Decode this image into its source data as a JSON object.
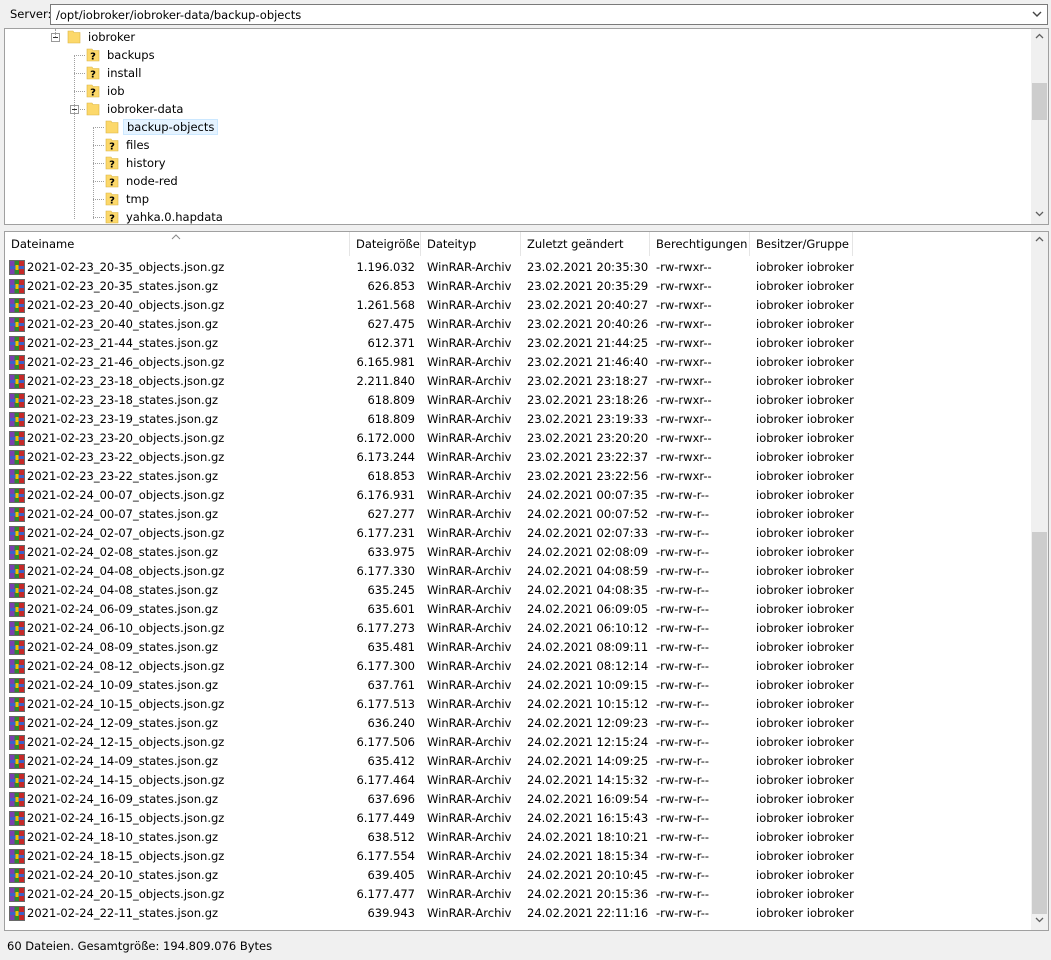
{
  "server": {
    "label": "Server:",
    "path": "/opt/iobroker/iobroker-data/backup-objects"
  },
  "tree": [
    {
      "name": "iobroker",
      "level": 0,
      "icon": "folder",
      "expanded": true
    },
    {
      "name": "backups",
      "level": 1,
      "icon": "unknown-folder"
    },
    {
      "name": "install",
      "level": 1,
      "icon": "unknown-folder"
    },
    {
      "name": "iob",
      "level": 1,
      "icon": "unknown-folder"
    },
    {
      "name": "iobroker-data",
      "level": 1,
      "icon": "folder",
      "expanded": true
    },
    {
      "name": "backup-objects",
      "level": 2,
      "icon": "folder",
      "selected": true
    },
    {
      "name": "files",
      "level": 2,
      "icon": "unknown-folder"
    },
    {
      "name": "history",
      "level": 2,
      "icon": "unknown-folder"
    },
    {
      "name": "node-red",
      "level": 2,
      "icon": "unknown-folder"
    },
    {
      "name": "tmp",
      "level": 2,
      "icon": "unknown-folder"
    },
    {
      "name": "yahka.0.hapdata",
      "level": 2,
      "icon": "unknown-folder"
    }
  ],
  "columns": {
    "name": "Dateiname",
    "size": "Dateigröße",
    "type": "Dateityp",
    "modified": "Zuletzt geändert",
    "permissions": "Berechtigungen",
    "owner": "Besitzer/Gruppe"
  },
  "files": [
    {
      "name": "2021-02-23_20-35_objects.json.gz",
      "size": "1.196.032",
      "type": "WinRAR-Archiv",
      "modified": "23.02.2021 20:35:30",
      "permissions": "-rw-rwxr--",
      "owner": "iobroker iobroker"
    },
    {
      "name": "2021-02-23_20-35_states.json.gz",
      "size": "626.853",
      "type": "WinRAR-Archiv",
      "modified": "23.02.2021 20:35:29",
      "permissions": "-rw-rwxr--",
      "owner": "iobroker iobroker"
    },
    {
      "name": "2021-02-23_20-40_objects.json.gz",
      "size": "1.261.568",
      "type": "WinRAR-Archiv",
      "modified": "23.02.2021 20:40:27",
      "permissions": "-rw-rwxr--",
      "owner": "iobroker iobroker"
    },
    {
      "name": "2021-02-23_20-40_states.json.gz",
      "size": "627.475",
      "type": "WinRAR-Archiv",
      "modified": "23.02.2021 20:40:26",
      "permissions": "-rw-rwxr--",
      "owner": "iobroker iobroker"
    },
    {
      "name": "2021-02-23_21-44_states.json.gz",
      "size": "612.371",
      "type": "WinRAR-Archiv",
      "modified": "23.02.2021 21:44:25",
      "permissions": "-rw-rwxr--",
      "owner": "iobroker iobroker"
    },
    {
      "name": "2021-02-23_21-46_objects.json.gz",
      "size": "6.165.981",
      "type": "WinRAR-Archiv",
      "modified": "23.02.2021 21:46:40",
      "permissions": "-rw-rwxr--",
      "owner": "iobroker iobroker"
    },
    {
      "name": "2021-02-23_23-18_objects.json.gz",
      "size": "2.211.840",
      "type": "WinRAR-Archiv",
      "modified": "23.02.2021 23:18:27",
      "permissions": "-rw-rwxr--",
      "owner": "iobroker iobroker"
    },
    {
      "name": "2021-02-23_23-18_states.json.gz",
      "size": "618.809",
      "type": "WinRAR-Archiv",
      "modified": "23.02.2021 23:18:26",
      "permissions": "-rw-rwxr--",
      "owner": "iobroker iobroker"
    },
    {
      "name": "2021-02-23_23-19_states.json.gz",
      "size": "618.809",
      "type": "WinRAR-Archiv",
      "modified": "23.02.2021 23:19:33",
      "permissions": "-rw-rwxr--",
      "owner": "iobroker iobroker"
    },
    {
      "name": "2021-02-23_23-20_objects.json.gz",
      "size": "6.172.000",
      "type": "WinRAR-Archiv",
      "modified": "23.02.2021 23:20:20",
      "permissions": "-rw-rwxr--",
      "owner": "iobroker iobroker"
    },
    {
      "name": "2021-02-23_23-22_objects.json.gz",
      "size": "6.173.244",
      "type": "WinRAR-Archiv",
      "modified": "23.02.2021 23:22:37",
      "permissions": "-rw-rwxr--",
      "owner": "iobroker iobroker"
    },
    {
      "name": "2021-02-23_23-22_states.json.gz",
      "size": "618.853",
      "type": "WinRAR-Archiv",
      "modified": "23.02.2021 23:22:56",
      "permissions": "-rw-rwxr--",
      "owner": "iobroker iobroker"
    },
    {
      "name": "2021-02-24_00-07_objects.json.gz",
      "size": "6.176.931",
      "type": "WinRAR-Archiv",
      "modified": "24.02.2021 00:07:35",
      "permissions": "-rw-rw-r--",
      "owner": "iobroker iobroker"
    },
    {
      "name": "2021-02-24_00-07_states.json.gz",
      "size": "627.277",
      "type": "WinRAR-Archiv",
      "modified": "24.02.2021 00:07:52",
      "permissions": "-rw-rw-r--",
      "owner": "iobroker iobroker"
    },
    {
      "name": "2021-02-24_02-07_objects.json.gz",
      "size": "6.177.231",
      "type": "WinRAR-Archiv",
      "modified": "24.02.2021 02:07:33",
      "permissions": "-rw-rw-r--",
      "owner": "iobroker iobroker"
    },
    {
      "name": "2021-02-24_02-08_states.json.gz",
      "size": "633.975",
      "type": "WinRAR-Archiv",
      "modified": "24.02.2021 02:08:09",
      "permissions": "-rw-rw-r--",
      "owner": "iobroker iobroker"
    },
    {
      "name": "2021-02-24_04-08_objects.json.gz",
      "size": "6.177.330",
      "type": "WinRAR-Archiv",
      "modified": "24.02.2021 04:08:59",
      "permissions": "-rw-rw-r--",
      "owner": "iobroker iobroker"
    },
    {
      "name": "2021-02-24_04-08_states.json.gz",
      "size": "635.245",
      "type": "WinRAR-Archiv",
      "modified": "24.02.2021 04:08:35",
      "permissions": "-rw-rw-r--",
      "owner": "iobroker iobroker"
    },
    {
      "name": "2021-02-24_06-09_states.json.gz",
      "size": "635.601",
      "type": "WinRAR-Archiv",
      "modified": "24.02.2021 06:09:05",
      "permissions": "-rw-rw-r--",
      "owner": "iobroker iobroker"
    },
    {
      "name": "2021-02-24_06-10_objects.json.gz",
      "size": "6.177.273",
      "type": "WinRAR-Archiv",
      "modified": "24.02.2021 06:10:12",
      "permissions": "-rw-rw-r--",
      "owner": "iobroker iobroker"
    },
    {
      "name": "2021-02-24_08-09_states.json.gz",
      "size": "635.481",
      "type": "WinRAR-Archiv",
      "modified": "24.02.2021 08:09:11",
      "permissions": "-rw-rw-r--",
      "owner": "iobroker iobroker"
    },
    {
      "name": "2021-02-24_08-12_objects.json.gz",
      "size": "6.177.300",
      "type": "WinRAR-Archiv",
      "modified": "24.02.2021 08:12:14",
      "permissions": "-rw-rw-r--",
      "owner": "iobroker iobroker"
    },
    {
      "name": "2021-02-24_10-09_states.json.gz",
      "size": "637.761",
      "type": "WinRAR-Archiv",
      "modified": "24.02.2021 10:09:15",
      "permissions": "-rw-rw-r--",
      "owner": "iobroker iobroker"
    },
    {
      "name": "2021-02-24_10-15_objects.json.gz",
      "size": "6.177.513",
      "type": "WinRAR-Archiv",
      "modified": "24.02.2021 10:15:12",
      "permissions": "-rw-rw-r--",
      "owner": "iobroker iobroker"
    },
    {
      "name": "2021-02-24_12-09_states.json.gz",
      "size": "636.240",
      "type": "WinRAR-Archiv",
      "modified": "24.02.2021 12:09:23",
      "permissions": "-rw-rw-r--",
      "owner": "iobroker iobroker"
    },
    {
      "name": "2021-02-24_12-15_objects.json.gz",
      "size": "6.177.506",
      "type": "WinRAR-Archiv",
      "modified": "24.02.2021 12:15:24",
      "permissions": "-rw-rw-r--",
      "owner": "iobroker iobroker"
    },
    {
      "name": "2021-02-24_14-09_states.json.gz",
      "size": "635.412",
      "type": "WinRAR-Archiv",
      "modified": "24.02.2021 14:09:25",
      "permissions": "-rw-rw-r--",
      "owner": "iobroker iobroker"
    },
    {
      "name": "2021-02-24_14-15_objects.json.gz",
      "size": "6.177.464",
      "type": "WinRAR-Archiv",
      "modified": "24.02.2021 14:15:32",
      "permissions": "-rw-rw-r--",
      "owner": "iobroker iobroker"
    },
    {
      "name": "2021-02-24_16-09_states.json.gz",
      "size": "637.696",
      "type": "WinRAR-Archiv",
      "modified": "24.02.2021 16:09:54",
      "permissions": "-rw-rw-r--",
      "owner": "iobroker iobroker"
    },
    {
      "name": "2021-02-24_16-15_objects.json.gz",
      "size": "6.177.449",
      "type": "WinRAR-Archiv",
      "modified": "24.02.2021 16:15:43",
      "permissions": "-rw-rw-r--",
      "owner": "iobroker iobroker"
    },
    {
      "name": "2021-02-24_18-10_states.json.gz",
      "size": "638.512",
      "type": "WinRAR-Archiv",
      "modified": "24.02.2021 18:10:21",
      "permissions": "-rw-rw-r--",
      "owner": "iobroker iobroker"
    },
    {
      "name": "2021-02-24_18-15_objects.json.gz",
      "size": "6.177.554",
      "type": "WinRAR-Archiv",
      "modified": "24.02.2021 18:15:34",
      "permissions": "-rw-rw-r--",
      "owner": "iobroker iobroker"
    },
    {
      "name": "2021-02-24_20-10_states.json.gz",
      "size": "639.405",
      "type": "WinRAR-Archiv",
      "modified": "24.02.2021 20:10:45",
      "permissions": "-rw-rw-r--",
      "owner": "iobroker iobroker"
    },
    {
      "name": "2021-02-24_20-15_objects.json.gz",
      "size": "6.177.477",
      "type": "WinRAR-Archiv",
      "modified": "24.02.2021 20:15:36",
      "permissions": "-rw-rw-r--",
      "owner": "iobroker iobroker"
    },
    {
      "name": "2021-02-24_22-11_states.json.gz",
      "size": "639.943",
      "type": "WinRAR-Archiv",
      "modified": "24.02.2021 22:11:16",
      "permissions": "-rw-rw-r--",
      "owner": "iobroker iobroker"
    }
  ],
  "status": {
    "text": "60 Dateien. Gesamtgröße: 194.809.076 Bytes"
  },
  "icons": {
    "folder": "folder-icon",
    "unknown_folder": "unknown-folder-icon",
    "archive": "winrar-archive-icon",
    "sort": "sort-ascending-icon"
  },
  "colors": {
    "folder": "#fcd86a",
    "selection": "#e5f3ff",
    "scroll_thumb": "#cdcdcd"
  }
}
